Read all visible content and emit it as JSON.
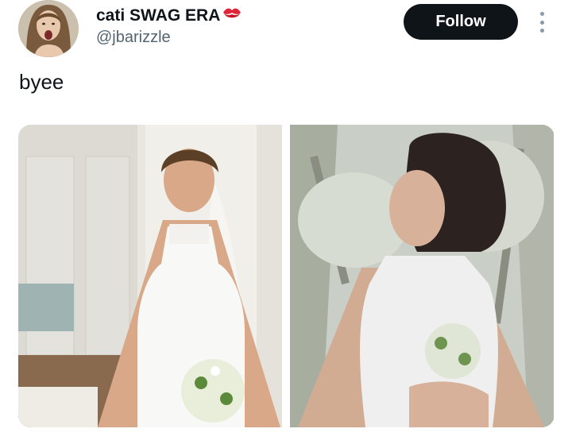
{
  "author": {
    "display_name": "cati SWAG ERA",
    "emoji_icon": "kiss-mark-icon",
    "handle": "@jbarizzle"
  },
  "actions": {
    "follow_label": "Follow",
    "more_icon": "more-vertical-icon"
  },
  "tweet": {
    "text": "byee"
  },
  "media": [
    {
      "name": "photo-1"
    },
    {
      "name": "photo-2"
    }
  ],
  "colors": {
    "primary_text": "#0f1419",
    "secondary_text": "#536471",
    "follow_bg": "#0f1419",
    "follow_text": "#ffffff",
    "kiss_red": "#e0243a"
  }
}
